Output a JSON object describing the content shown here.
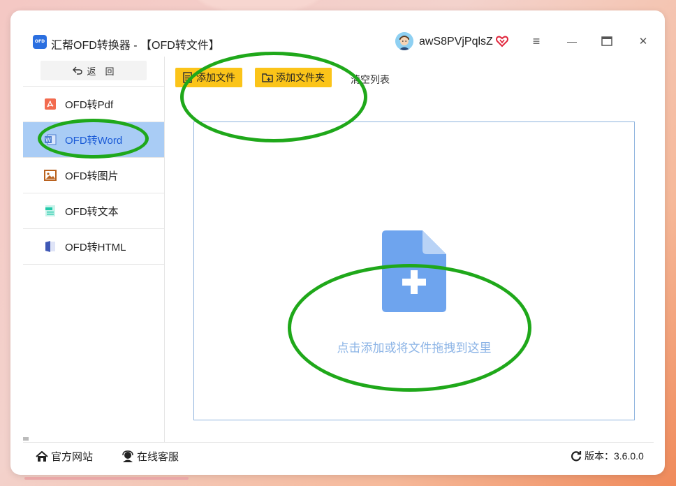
{
  "titlebar": {
    "logo_text": "OFD",
    "title": "汇帮OFD转换器 - 【OFD转文件】",
    "username": "awS8PVjPqlsZ",
    "icons": {
      "vip": "vip-heart-icon",
      "menu": "menu-icon",
      "minimize": "minimize-icon",
      "maximize": "maximize-icon",
      "close": "close-icon"
    },
    "menu_glyph": "≡",
    "minimize_glyph": "—",
    "close_glyph": "✕"
  },
  "sidebar": {
    "back_label": "返　回",
    "items": [
      {
        "label": "OFD转Pdf",
        "icon": "pdf-icon",
        "active": false
      },
      {
        "label": "OFD转Word",
        "icon": "word-icon",
        "active": true
      },
      {
        "label": "OFD转图片",
        "icon": "image-icon",
        "active": false
      },
      {
        "label": "OFD转文本",
        "icon": "text-icon",
        "active": false
      },
      {
        "label": "OFD转HTML",
        "icon": "html-icon",
        "active": false
      }
    ]
  },
  "toolbar": {
    "add_file": "添加文件",
    "add_folder": "添加文件夹",
    "clear_list": "清空列表"
  },
  "dropzone": {
    "icon": "add-file-icon",
    "text": "点击添加或将文件拖拽到这里"
  },
  "statusbar": {
    "website": "官方网站",
    "support": "在线客服",
    "version": "版本：3.6.0.0"
  },
  "colors": {
    "accent": "#fbc419",
    "active_bg": "#a9ccf5",
    "active_text": "#1a5ad6",
    "drop_border": "#8db2dd",
    "drop_text": "#8cb4e6",
    "annotation": "#1fa81a"
  }
}
